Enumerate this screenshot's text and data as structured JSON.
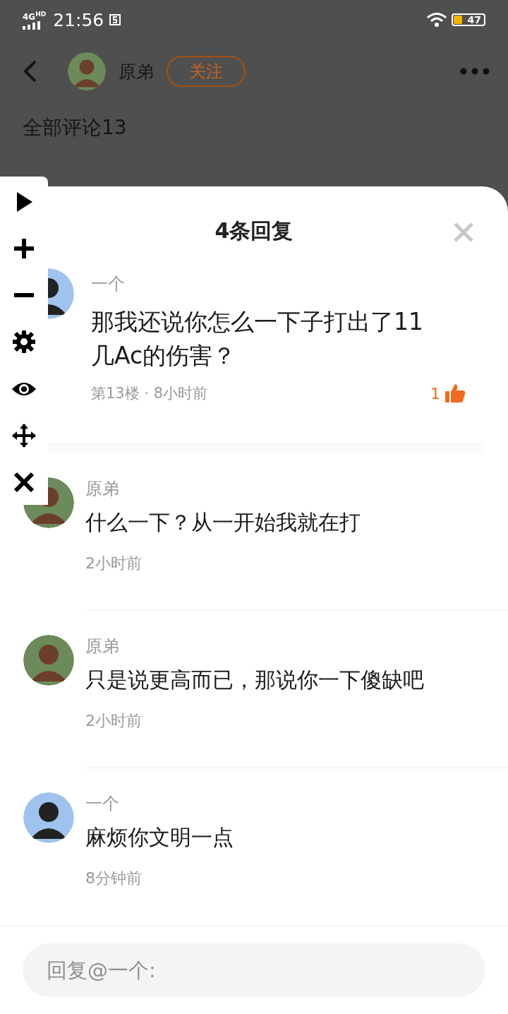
{
  "status_bar": {
    "network": "4G",
    "network_badge": "HD",
    "time": "21:56",
    "battery": "47"
  },
  "header": {
    "username": "原弟",
    "follow_button": "关注",
    "section_title": "全部评论13"
  },
  "sheet": {
    "title": "4条回复",
    "main_comment": {
      "author": "一个",
      "text": "那我还说你怎么一下子打出了11几Ac的伤害？",
      "meta": "第13楼 · 8小时前",
      "likes": "1",
      "liked": true
    },
    "replies": [
      {
        "author": "原弟",
        "text": "什么一下？从一开始我就在打",
        "time": "2小时前"
      },
      {
        "author": "原弟",
        "text": "只是说更高而已，那说你一下傻缺吧",
        "time": "2小时前"
      },
      {
        "author": "一个",
        "text": "麻烦你文明一点",
        "time": "8分钟前"
      }
    ],
    "reply_box": {
      "placeholder": "回复@一个:"
    }
  }
}
